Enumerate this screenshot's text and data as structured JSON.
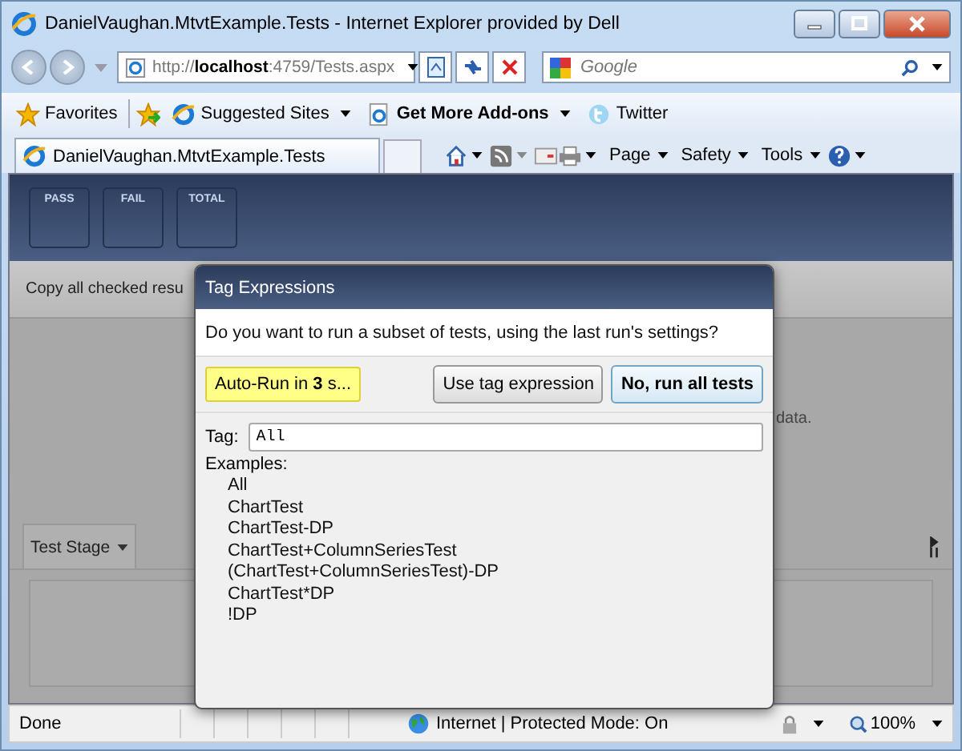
{
  "window": {
    "title": "DanielVaughan.MtvtExample.Tests - Internet Explorer provided by Dell"
  },
  "address": {
    "prefix": "http://",
    "host": "localhost",
    "rest": ":4759/Tests.aspx"
  },
  "search": {
    "placeholder": "Google"
  },
  "favorites_bar": [
    {
      "label": "Favorites",
      "kind": "star",
      "dropdown": false,
      "bold": false
    },
    {
      "label": "Suggested Sites",
      "kind": "ie",
      "dropdown": true,
      "bold": false
    },
    {
      "label": "Get More Add-ons",
      "kind": "page",
      "dropdown": true,
      "bold": true
    },
    {
      "label": "Twitter",
      "kind": "bird",
      "dropdown": false,
      "bold": false
    }
  ],
  "tab": {
    "title": "DanielVaughan.MtvtExample.Tests"
  },
  "command_bar": [
    "Page",
    "Safety",
    "Tools"
  ],
  "summary": [
    "PASS",
    "FAIL",
    "TOTAL"
  ],
  "action_bar": {
    "text": "Copy all checked resu"
  },
  "background_text": "data.",
  "stage_tab": {
    "label": "Test Stage"
  },
  "dialog": {
    "title": "Tag Expressions",
    "question": "Do you want to run a subset of tests, using the last run's settings?",
    "countdown": "Auto-Run in **3** s...",
    "buttons": [
      {
        "label": "Use tag expression",
        "default": false
      },
      {
        "label": "No, run all tests",
        "default": true
      }
    ],
    "tag_label": "Tag:",
    "tag_value": "All",
    "examples_label": "Examples:",
    "examples": [
      "All",
      "ChartTest",
      "ChartTest-DP",
      "ChartTest+ColumnSeriesTest",
      "(ChartTest+ColumnSeriesTest)-DP",
      "ChartTest*DP",
      "!DP"
    ]
  },
  "status_bar": {
    "text": "Done",
    "zone": "Internet | Protected Mode: On",
    "zoom": "100%"
  }
}
